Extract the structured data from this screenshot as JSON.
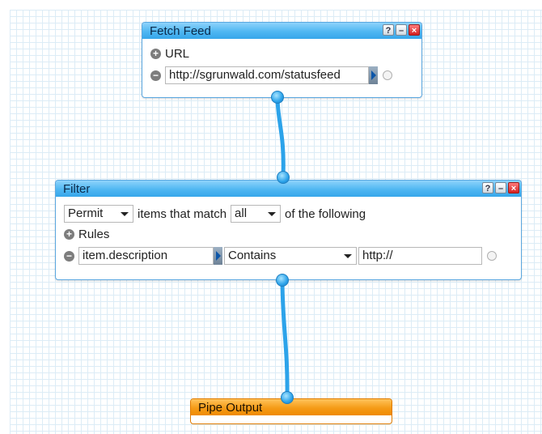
{
  "fetch_feed": {
    "title": "Fetch Feed",
    "buttons": [
      "?",
      "–",
      "×"
    ],
    "url_label": "URL",
    "url_value": "http://sgrunwald.com/statusfeed"
  },
  "filter": {
    "title": "Filter",
    "buttons": [
      "?",
      "–",
      "×"
    ],
    "mode": "Permit",
    "text_items_match": "items that match",
    "match": "all",
    "text_of_following": "of the following",
    "rules_label": "Rules",
    "rule": {
      "field": "item.description",
      "operator": "Contains",
      "value": "http://"
    }
  },
  "output": {
    "title": "Pipe Output"
  },
  "colors": {
    "module_border": "#5aa7e0",
    "wire": "#2ca3ea",
    "output_accent": "#f59b17"
  }
}
